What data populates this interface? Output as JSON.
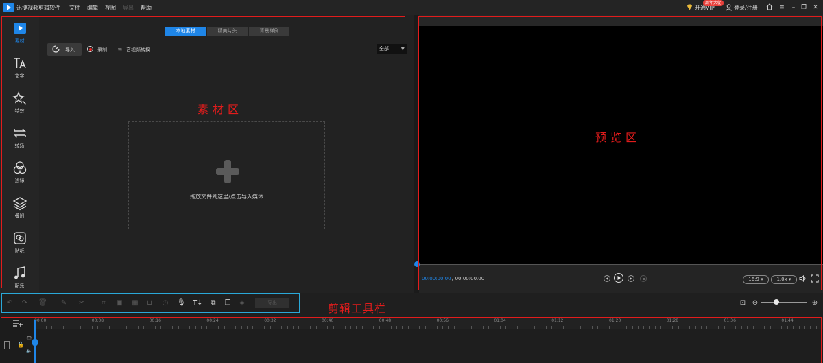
{
  "titlebar": {
    "app_name": "迅捷视频剪辑软件",
    "menu": [
      "文件",
      "编辑",
      "视图",
      "导出",
      "帮助"
    ],
    "vip_label": "开通VIP",
    "vip_badge": "周年大促",
    "login_label": "登录/注册"
  },
  "sidebar": {
    "items": [
      {
        "label": "素材",
        "icon": "play-folder-icon"
      },
      {
        "label": "文字",
        "icon": "text-icon"
      },
      {
        "label": "特效",
        "icon": "sparkle-icon"
      },
      {
        "label": "转场",
        "icon": "transition-icon"
      },
      {
        "label": "滤镜",
        "icon": "filter-icon"
      },
      {
        "label": "叠附",
        "icon": "layers-icon"
      },
      {
        "label": "贴纸",
        "icon": "sticker-icon"
      },
      {
        "label": "配乐",
        "icon": "music-icon"
      }
    ]
  },
  "material": {
    "tabs": [
      "本地素材",
      "精美片头",
      "背景样例"
    ],
    "import_label": "导入",
    "record_label": "录制",
    "convert_label": "音视频转换",
    "filter_value": "全部",
    "drop_text": "拖放文件到这里/点击导入媒体",
    "annotation": "素材区"
  },
  "preview": {
    "annotation": "预览区",
    "current_time": "00:00:00.00",
    "total_time": "/ 00:00:00.00",
    "aspect_ratio": "16:9",
    "speed": "1.0x"
  },
  "edit_toolbar": {
    "annotation": "剪辑工具栏",
    "export_label": "导出"
  },
  "timeline": {
    "ticks": [
      "00:00",
      "00:08",
      "00:16",
      "00:24",
      "00:32",
      "00:40",
      "00:48",
      "00:56",
      "01:04",
      "01:12",
      "01:20",
      "01:28",
      "01:36",
      "01:44"
    ]
  },
  "colors": {
    "accent": "#1f86e8",
    "annotation_red": "#e21c1c",
    "annotation_cyan": "#2aa8d8"
  }
}
